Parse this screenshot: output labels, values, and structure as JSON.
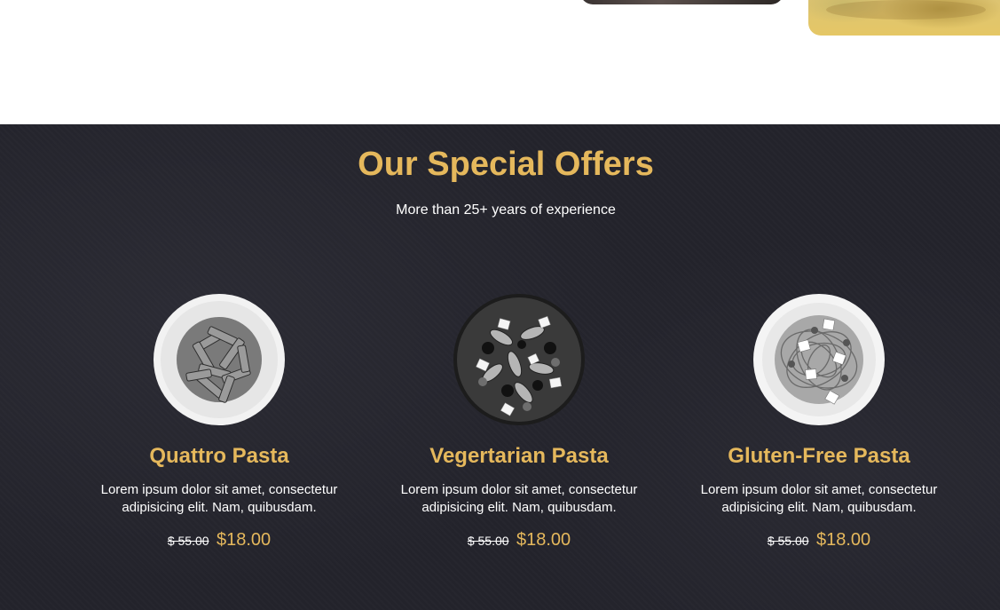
{
  "offers": {
    "title": "Our Special Offers",
    "subtitle": "More than 25+ years of experience",
    "items": [
      {
        "name": "Quattro Pasta",
        "description": "Lorem ipsum dolor sit amet, consectetur adipisicing elit. Nam, quibusdam.",
        "old_price": "$ 55.00",
        "price": "$18.00",
        "image": "penne-pasta-plate"
      },
      {
        "name": "Vegertarian Pasta",
        "description": "Lorem ipsum dolor sit amet, consectetur adipisicing elit. Nam, quibusdam.",
        "old_price": "$ 55.00",
        "price": "$18.00",
        "image": "fusilli-vegetable-pasta-plate"
      },
      {
        "name": "Gluten-Free Pasta",
        "description": "Lorem ipsum dolor sit amet, consectetur adipisicing elit. Nam, quibusdam.",
        "old_price": "$ 55.00",
        "price": "$18.00",
        "image": "spaghetti-feta-plate"
      }
    ]
  },
  "colors": {
    "accent": "#e5b85c",
    "section_background": "#23232b",
    "text": "#ffffff"
  }
}
